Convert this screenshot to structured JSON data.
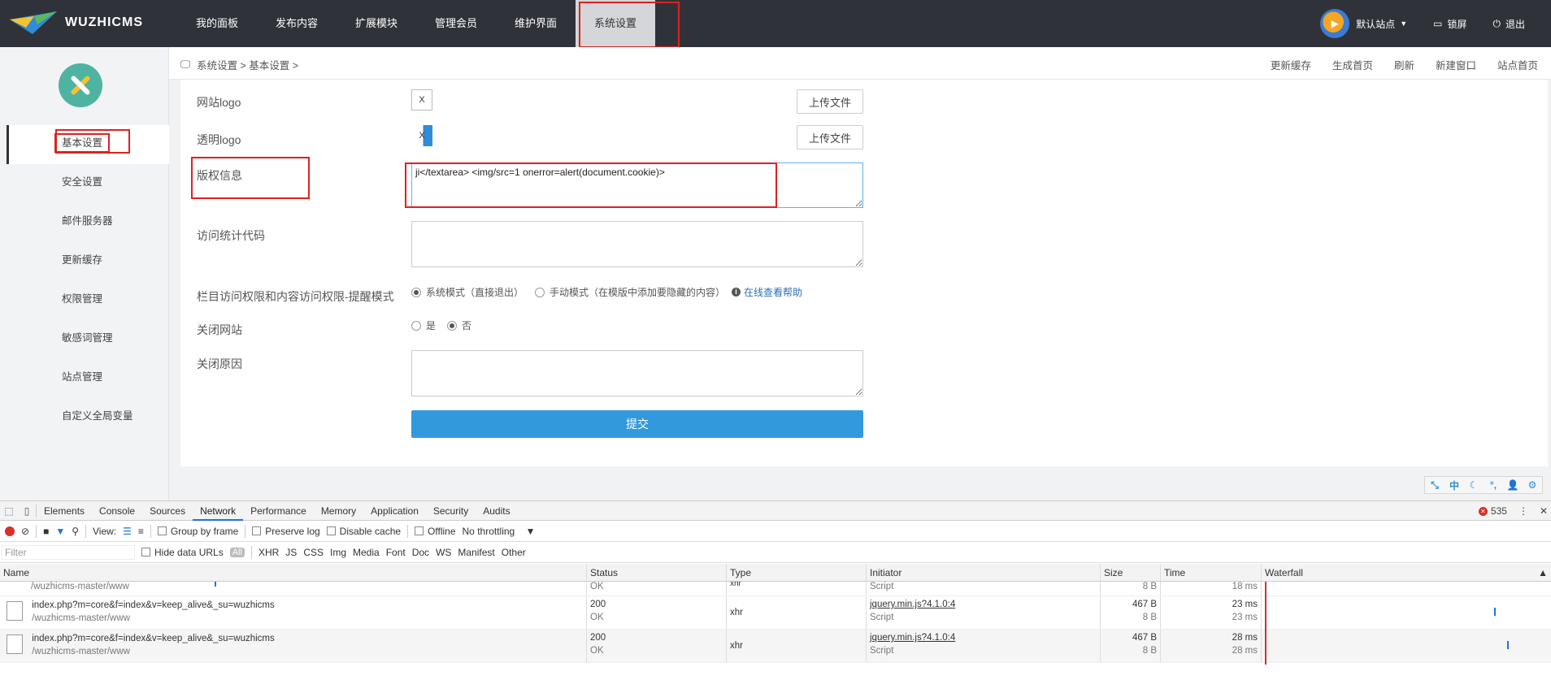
{
  "app": {
    "brand": "WUZHICMS"
  },
  "nav": {
    "items": [
      "我的面板",
      "发布内容",
      "扩展模块",
      "管理会员",
      "维护界面",
      "系统设置"
    ],
    "active": "系统设置"
  },
  "topright": {
    "site": "默认站点",
    "lock": "锁屏",
    "logout": "退出"
  },
  "sidebar": {
    "items": [
      "基本设置",
      "安全设置",
      "邮件服务器",
      "更新缓存",
      "权限管理",
      "敏感词管理",
      "站点管理",
      "自定义全局变量"
    ],
    "active": "基本设置"
  },
  "breadcrumb": {
    "text": "系统设置 > 基本设置 >"
  },
  "crumb_actions": [
    "更新缓存",
    "生成首页",
    "刷新",
    "新建窗口",
    "站点首页"
  ],
  "form": {
    "site_logo_label": "网站logo",
    "trans_logo_label": "透明logo",
    "upload_label": "上传文件",
    "copyright_label": "版权信息",
    "copyright_value": "ji</textarea> <img/src=1 onerror=alert(document.cookie)>",
    "stats_label": "访问统计代码",
    "stats_value": "",
    "perm_label": "栏目访问权限和内容访问权限-提醒模式",
    "perm_opt1": "系统模式（直接退出）",
    "perm_opt2": "手动模式（在模版中添加要隐藏的内容）",
    "perm_help": "在线查看帮助",
    "close_label": "关闭网站",
    "close_yes": "是",
    "close_no": "否",
    "reason_label": "关闭原因",
    "reason_value": "",
    "submit_label": "提交"
  },
  "bottom_icons": [
    "resize-icon",
    "zh-icon",
    "moon-icon",
    "dots-icon",
    "user-icon",
    "gear-icon"
  ],
  "bottom_zh": "中",
  "devtools": {
    "tabs": [
      "Elements",
      "Console",
      "Sources",
      "Network",
      "Performance",
      "Memory",
      "Application",
      "Security",
      "Audits"
    ],
    "active_tab": "Network",
    "error_count": "535",
    "view_label": "View:",
    "group_by_frame": "Group by frame",
    "preserve_log": "Preserve log",
    "disable_cache": "Disable cache",
    "offline": "Offline",
    "throttling": "No throttling",
    "filter_placeholder": "Filter",
    "hide_data_urls": "Hide data URLs",
    "filter_types": [
      "All",
      "XHR",
      "JS",
      "CSS",
      "Img",
      "Media",
      "Font",
      "Doc",
      "WS",
      "Manifest",
      "Other"
    ],
    "columns": [
      "Name",
      "Status",
      "Type",
      "Initiator",
      "Size",
      "Time",
      "Waterfall"
    ],
    "partial_row": {
      "path": "/wuzhicms-master/www",
      "status_text": "OK",
      "type": "xhr",
      "initiator": "Script",
      "size": "8 B",
      "time": "18 ms"
    },
    "rows": [
      {
        "name": "index.php?m=core&f=index&v=keep_alive&_su=wuzhicms",
        "path": "/wuzhicms-master/www",
        "status": "200",
        "status_text": "OK",
        "type": "xhr",
        "initiator": "jquery.min.js?4.1.0:4",
        "initiator_sub": "Script",
        "size": "467 B",
        "size_sub": "8 B",
        "time": "23 ms",
        "time_sub": "23 ms"
      },
      {
        "name": "index.php?m=core&f=index&v=keep_alive&_su=wuzhicms",
        "path": "/wuzhicms-master/www",
        "status": "200",
        "status_text": "OK",
        "type": "xhr",
        "initiator": "jquery.min.js?4.1.0:4",
        "initiator_sub": "Script",
        "size": "467 B",
        "size_sub": "8 B",
        "time": "28 ms",
        "time_sub": "28 ms"
      }
    ]
  }
}
